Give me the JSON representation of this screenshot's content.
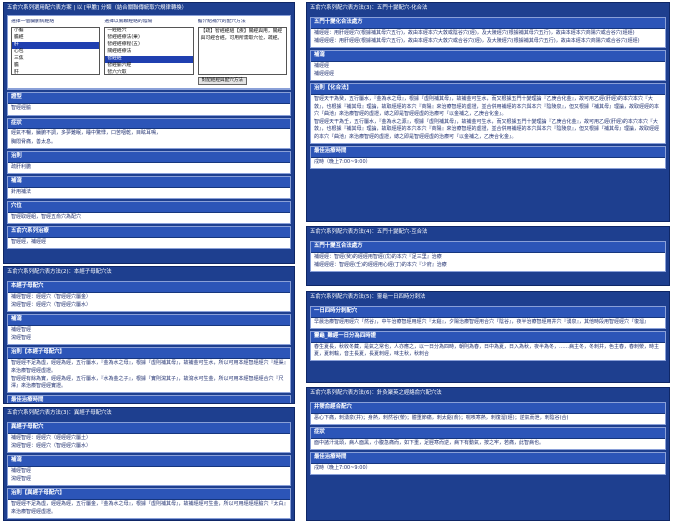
{
  "panel1": {
    "title": "五俞穴系列選用配穴表方案 | 以 [甲膽] 分類（結合關聯傳統取穴規律轉換）",
    "selector": {
      "col1_label": "選擇一個臟腑病經絡",
      "col1_options": [
        "小膽",
        "膽經",
        "肝",
        "心包",
        "三焦",
        "膽",
        "肝"
      ],
      "col2_label": "選擇以關聯經絡的陰陽",
      "col2_options": [
        "一經經穴",
        "智經經療法(果)",
        "智經經療程(五)",
        "關經經療法",
        "智經經",
        "智經腧六經",
        "智六穴取"
      ],
      "col3_label": "膽介紹補穴的配穴方法",
      "col3_text": "【疏】智經經組【疾】關經與用，關經與可經合經。可用所需取穴位，疏經。",
      "button": "對配經經與配穴方法"
    },
    "sections": [
      {
        "header": "證型",
        "lines": [
          "智經經腧"
        ]
      },
      {
        "header": "症狀",
        "lines": [
          "經氣不暢，臟腑不調，多夢難眠，睡中驚悸，口苦咽乾，目眩耳鳴，",
          "胸悶脅痛，善太息。"
        ]
      },
      {
        "header": "治則",
        "lines": [
          "疏肝利膽"
        ]
      },
      {
        "header": "補瀉",
        "lines": [
          "針用補法"
        ]
      },
      {
        "header": "穴位",
        "lines": [
          "智經取經組，智經五俞穴為配穴"
        ]
      },
      {
        "header": "五俞穴系列治療",
        "lines": [
          "智經經，補經經"
        ]
      }
    ]
  },
  "panel2": {
    "title": "五俞穴系列配穴表方法(2)：本經子母配穴法",
    "sections": [
      {
        "header": "本經子母配穴",
        "lines": [
          "補經智經：經經穴（智經經穴屬金）",
          "瀉經智經：經經穴（智經經穴屬水）"
        ]
      },
      {
        "header": "補瀉",
        "lines": [
          "補經智經",
          "瀉經智經"
        ]
      },
      {
        "header": "治則【本經子母配穴】",
        "lines": [
          "智經經不足為虛，經經為經，五行屬水，『金為水之母』，根據『虛則補其母』，故補金可生水，所以可用本經智經經穴『經渠』來治療智經經虛證。",
          "智經經有餘為實，經經為經，五行屬水，『水為金之子』，根據『實則瀉其子』，故瀉水可生金，所以可用本經智經經合穴『尺澤』來治療智經經實證。"
        ]
      },
      {
        "header": "最佳治療時間",
        "lines": [
          "寅時（晨上午3:00~5:00）"
        ]
      }
    ]
  },
  "panel3": {
    "title": "五俞穴系列配穴表方法(3)：異經子母配穴法",
    "sections": [
      {
        "header": "異經子母配穴",
        "lines": [
          "補經智經：經經穴（經經經穴屬土）",
          "瀉經智經：經經穴（智經經穴屬水）"
        ]
      },
      {
        "header": "補瀉",
        "lines": [
          "補經智經",
          "瀉經智經"
        ]
      },
      {
        "header": "治則【異經子母配穴】",
        "lines": [
          "智經經不足為虛，經經為經，五行屬金，『金為水之母』，根據『虛則補其母』，故補經經可生金，所以可用經經經腧穴『太白』來治療智經經虛證。"
        ]
      }
    ]
  },
  "panel4": {
    "title": "五俞穴系列配穴表方法(3)：五門十變配穴-化合法",
    "sections": [
      {
        "header": "五門十變化合法處方",
        "lines": [
          "補經經：用肝經經穴(根據補其母穴五行)，故由本經本穴大敦或陰谷穴(經)，及大陵經穴(根據補其母穴五行)，故由本經本穴商陽穴或合谷穴(經經)",
          "補經經經：用肝經經(根據補其母穴五行)，故由本經本穴大敦穴或合谷穴(經)，及大陵經穴(根據補其母穴五行)，故由本經本穴商陽穴或合谷穴(經經)"
        ]
      },
      {
        "header": "補瀉",
        "lines": [
          "補經經",
          "補經經經"
        ]
      },
      {
        "header": "治則【化合法】",
        "lines": [
          "智經天干為癸，五行屬水，『金為水之母』，根據『虛則補其母』，故補金可生水，而又根據五門十變理論『乙庚合化金』，故可用乙經(肝經)的本穴本穴『大敦』，也根據『補其母』理論，故取經經的本穴『商陽』來治療智經的虛證，並合併用補經的本穴與本穴『陰陵泉』，但又根據『補其母』理論，故取經經的本穴『曲池』來治療智經的虛證，總之即是智經經虛的治療可『以金補之，乙庚合化金』。",
          "智經經天干為壬，五行屬水，『金為水之源』，根據『虛則補其母』，故補金可生水，而又根據五門十變理論『乙庚合化金』，故可用乙經(肝經)的本穴本穴『大敦』，也根據『補其母』理論，故取經經的本穴本穴『商陽』來治療智經的虛證，並合併用補經的本穴與本穴『陰陵泉』，但又根據『補其母』理論，故取經經的本穴『曲池』來治療智經的虛證，總之即是智經經虛的治療可『以金補之，乙庚合化金』。"
        ]
      },
      {
        "header": "最佳治療時間",
        "lines": [
          "戌時（晚上7:00~9:00）"
        ]
      }
    ]
  },
  "panel5": {
    "title": "五俞穴系列配穴表方法(4)：五門十變配穴-互合法",
    "sections": [
      {
        "header": "五門十變互合法處方",
        "lines": [
          "補經經：智經(癸)的經經用智經(戊)的本穴『足三里』治療",
          "補經經經：智經經(壬)的經經用心經(丁)的本穴『少府』治療"
        ]
      }
    ]
  },
  "panel6": {
    "title": "五俞穴系列配穴表方法(5)：靈龜一日四時分刺法",
    "sections": [
      {
        "header": "一日四時分刺配穴",
        "lines": [
          "早晨治療智經用經穴『然谷』，中午治療智經用經穴『太谿』，夕陽治療智經用合穴『陰谷』，夜半治療智經用井穴『湧泉』，其他時段用智經經穴『復溜』"
        ]
      },
      {
        "header": "靈龜_難經一日分為四時證",
        "lines": [
          "春生夏長，秋收冬藏，是氣之常也，人亦應之，以一日分為四時，朝則為春，日中為夏，日入為秋，夜半為冬，……病主冬，冬刺井，色主春，春刺滎，時主夏，夏刺輸，音主長夏，長夏刺經，味主秋，秋刺合"
        ]
      }
    ]
  },
  "panel7": {
    "title": "五俞穴系列配穴表方法(6)：針灸聚英之經絡俞穴配穴法",
    "sections": [
      {
        "header": "井滎俞經合配穴",
        "lines": [
          "恶心下痛，刺湧泉(井)；身熱，刺然谷(滎)；體重節痛，刺太谿(俞)；喘咳寒熱，刺復溜(經)；逆氣而泄，刺陰谷(合)"
        ]
      },
      {
        "header": "症狀",
        "lines": [
          "面中諸汗涎頭，病人面黑，小腹急痛而，如下重，足脛寒而逆，病下有動氣，按之牢，若痛，此智病也。"
        ]
      },
      {
        "header": "最佳治療時間",
        "lines": [
          "戌時（晚上7:00~9:00）"
        ]
      }
    ]
  }
}
